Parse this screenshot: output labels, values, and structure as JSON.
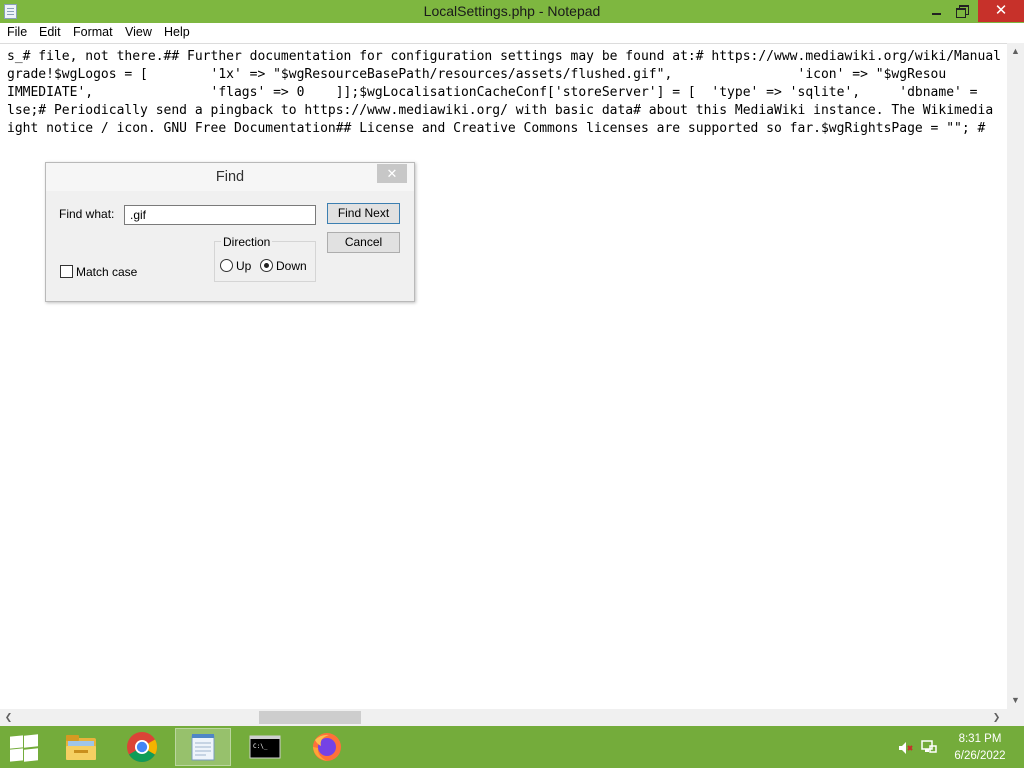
{
  "window": {
    "title": "LocalSettings.php - Notepad",
    "controls": {
      "minimize": "",
      "maximize": "",
      "close": "✕"
    }
  },
  "menu": {
    "items": [
      "File",
      "Edit",
      "Format",
      "View",
      "Help"
    ]
  },
  "editor": {
    "lines": [
      "s_# file, not there.## Further documentation for configuration settings may be found at:# https://www.mediawiki.org/wiki/Manual",
      "grade!$wgLogos = [        '1x' => \"$wgResourceBasePath/resources/assets/flushed.gif\",                'icon' => \"$wgResou",
      "IMMEDIATE',               'flags' => 0    ]];$wgLocalisationCacheConf['storeServer'] = [  'type' => 'sqlite',     'dbname' =",
      "lse;# Periodically send a pingback to https://www.mediawiki.org/ with basic data# about this MediaWiki instance. The Wikimedia",
      "ight notice / icon. GNU Free Documentation## License and Creative Commons licenses are supported so far.$wgRightsPage = \"\"; #"
    ]
  },
  "scrollbars": {
    "left_arrow": "❮",
    "right_arrow": "❯",
    "up_arrow": "▲",
    "down_arrow": "▼"
  },
  "find_dialog": {
    "title": "Find",
    "close_label": "✕",
    "find_what_label": "Find what:",
    "find_what_value": ".gif",
    "find_next_label": "Find Next",
    "cancel_label": "Cancel",
    "direction_label": "Direction",
    "up_label": "Up",
    "down_label": "Down",
    "direction_selected": "Down",
    "match_case_label": "Match case",
    "match_case_checked": false
  },
  "taskbar": {
    "apps": [
      "file-explorer",
      "chrome",
      "notepad",
      "command-prompt",
      "firefox"
    ],
    "active_app": "notepad",
    "clock": {
      "time": "8:31 PM",
      "date": "6/26/2022"
    },
    "colors": {
      "taskbar": "#74ac3b",
      "titlebar": "#7eb740",
      "close": "#c7312a"
    }
  }
}
